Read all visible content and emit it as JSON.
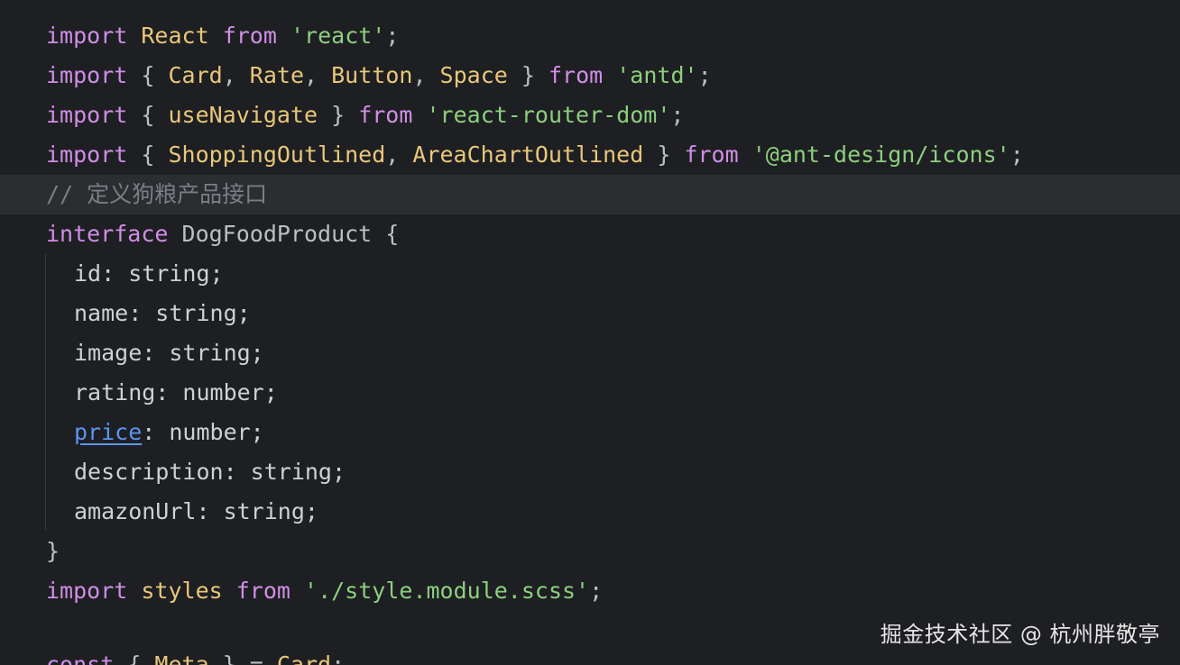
{
  "editor": {
    "theme_colors": {
      "background": "#1e1f22",
      "keyword": "#cf8ee6",
      "identifier": "#e8c77a",
      "string": "#8ccf7e",
      "comment": "#7a7e85",
      "link": "#5b95f0"
    },
    "line1": {
      "k1": "import",
      "t2": " ",
      "i3": "React",
      "t4": " ",
      "k5": "from",
      "t6": " ",
      "s7": "'react'",
      "t8": ";"
    },
    "line2": {
      "k1": "import",
      "t2": " { ",
      "i3": "Card",
      "t4": ", ",
      "i5": "Rate",
      "t6": ", ",
      "i7": "Button",
      "t8": ", ",
      "i9": "Space",
      "t10": " } ",
      "k11": "from",
      "t12": " ",
      "s13": "'antd'",
      "t14": ";"
    },
    "line3": {
      "k1": "import",
      "t2": " { ",
      "i3": "useNavigate",
      "t4": " } ",
      "k5": "from",
      "t6": " ",
      "s7": "'react-router-dom'",
      "t8": ";"
    },
    "line4": {
      "k1": "import",
      "t2": " { ",
      "i3": "ShoppingOutlined",
      "t4": ", ",
      "i5": "AreaChartOutlined",
      "t6": " } ",
      "k7": "from",
      "t8": " ",
      "s9": "'@ant-design/icons'",
      "t10": ";"
    },
    "line5": {
      "c1": "// 定义狗粮产品接口"
    },
    "line6": {
      "k1": "interface",
      "t2": " DogFoodProduct {"
    },
    "line7": {
      "t1": "id: string;"
    },
    "line8": {
      "t1": "name: string;"
    },
    "line9": {
      "t1": "image: string;"
    },
    "line10": {
      "t1": "rating: number;"
    },
    "line11": {
      "l1": "price",
      "t2": ": number;"
    },
    "line12": {
      "t1": "description: string;"
    },
    "line13": {
      "t1": "amazonUrl: string;"
    },
    "line14": {
      "t1": "}"
    },
    "line15": {
      "k1": "import",
      "t2": " ",
      "i3": "styles",
      "t4": " ",
      "k5": "from",
      "t6": " ",
      "s7": "'./style.module.scss'",
      "t8": ";"
    },
    "line17": {
      "k1": "const",
      "t2": " { ",
      "i3": "Meta",
      "t4": " } = ",
      "i5": "Card",
      "t6": ";"
    }
  },
  "watermark": "掘金技术社区 @ 杭州胖敬亭"
}
